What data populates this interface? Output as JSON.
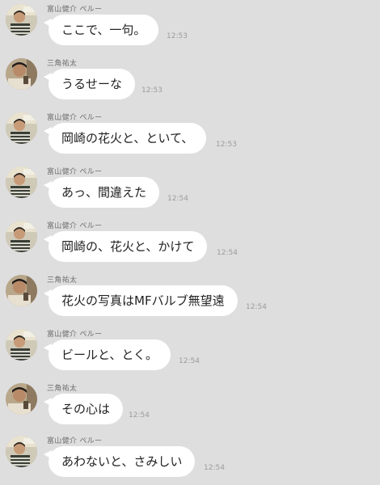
{
  "users": {
    "tomiyama": {
      "name": "富山健介 ペルー"
    },
    "misumi": {
      "name": "三角祐太"
    }
  },
  "messages": [
    {
      "sender": "富山健介 ペルー",
      "text": "ここで、一句。",
      "time": "12:53",
      "avatar": "tomiyama-avatar"
    },
    {
      "sender": "三角祐太",
      "text": "うるせーな",
      "time": "12:53",
      "avatar": "misumi-avatar"
    },
    {
      "sender": "富山健介 ペルー",
      "text": "岡崎の花火と、といて、",
      "time": "12:53",
      "avatar": "tomiyama-avatar"
    },
    {
      "sender": "富山健介 ペルー",
      "text": "あっ、間違えた",
      "time": "12:54",
      "avatar": "tomiyama-avatar"
    },
    {
      "sender": "富山健介 ペルー",
      "text": "岡崎の、花火と、かけて",
      "time": "12:54",
      "avatar": "tomiyama-avatar"
    },
    {
      "sender": "三角祐太",
      "text": "花火の写真はMFバルブ無望遠",
      "time": "12:54",
      "avatar": "misumi-avatar"
    },
    {
      "sender": "富山健介 ペルー",
      "text": "ビールと、とく。",
      "time": "12:54",
      "avatar": "tomiyama-avatar"
    },
    {
      "sender": "三角祐太",
      "text": "その心は",
      "time": "12:54",
      "avatar": "misumi-avatar"
    },
    {
      "sender": "富山健介 ペルー",
      "text": "あわないと、さみしい",
      "time": "12:54",
      "avatar": "tomiyama-avatar"
    }
  ],
  "colors": {
    "background": "#dedede",
    "bubble": "#ffffff",
    "text": "#222222",
    "meta": "#9c9c9c"
  }
}
